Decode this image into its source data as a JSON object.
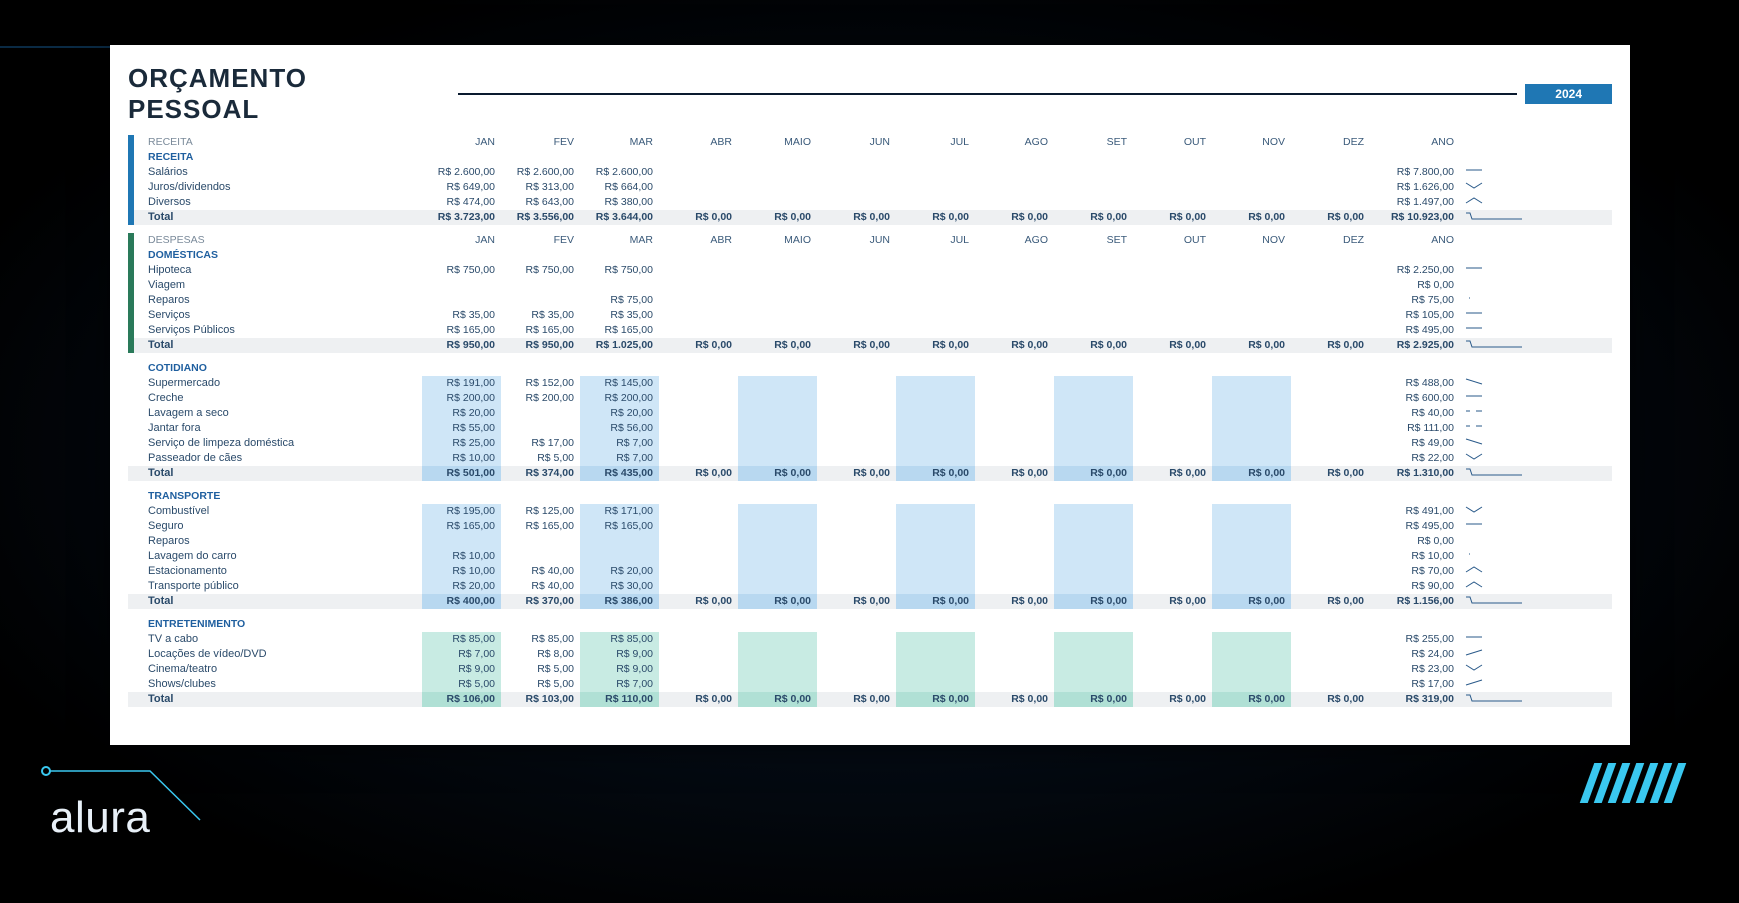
{
  "brand": "alura",
  "title": "ORÇAMENTO PESSOAL",
  "year": "2024",
  "months": [
    "JAN",
    "FEV",
    "MAR",
    "ABR",
    "MAIO",
    "JUN",
    "JUL",
    "AGO",
    "SET",
    "OUT",
    "NOV",
    "DEZ"
  ],
  "yearLabel": "ANO",
  "sections": [
    {
      "id": "receita",
      "bar": "blue",
      "shade": "none",
      "headerLabel": "RECEITA",
      "groupLabel": "RECEITA",
      "rows": [
        {
          "label": "Salários",
          "vals": [
            "R$ 2.600,00",
            "R$ 2.600,00",
            "R$ 2.600,00",
            "",
            "",
            "",
            "",
            "",
            "",
            "",
            "",
            ""
          ],
          "ano": "R$ 7.800,00",
          "spark": "flat"
        },
        {
          "label": "Juros/dividendos",
          "vals": [
            "R$ 649,00",
            "R$ 313,00",
            "R$ 664,00",
            "",
            "",
            "",
            "",
            "",
            "",
            "",
            "",
            ""
          ],
          "ano": "R$ 1.626,00",
          "spark": "v"
        },
        {
          "label": "Diversos",
          "vals": [
            "R$ 474,00",
            "R$ 643,00",
            "R$ 380,00",
            "",
            "",
            "",
            "",
            "",
            "",
            "",
            "",
            ""
          ],
          "ano": "R$ 1.497,00",
          "spark": "nv"
        }
      ],
      "total": {
        "label": "Total",
        "vals": [
          "R$ 3.723,00",
          "R$ 3.556,00",
          "R$ 3.644,00",
          "R$ 0,00",
          "R$ 0,00",
          "R$ 0,00",
          "R$ 0,00",
          "R$ 0,00",
          "R$ 0,00",
          "R$ 0,00",
          "R$ 0,00",
          "R$ 0,00"
        ],
        "ano": "R$ 10.923,00",
        "spark": "drop"
      }
    },
    {
      "id": "despesas",
      "bar": "green",
      "shade": "none",
      "headerLabel": "DESPESAS",
      "groupLabel": "DOMÉSTICAS",
      "rows": [
        {
          "label": "Hipoteca",
          "vals": [
            "R$ 750,00",
            "R$ 750,00",
            "R$ 750,00",
            "",
            "",
            "",
            "",
            "",
            "",
            "",
            "",
            ""
          ],
          "ano": "R$ 2.250,00",
          "spark": "flat"
        },
        {
          "label": "Viagem",
          "vals": [
            "",
            "",
            "",
            "",
            "",
            "",
            "",
            "",
            "",
            "",
            "",
            ""
          ],
          "ano": "R$ 0,00",
          "spark": ""
        },
        {
          "label": "Reparos",
          "vals": [
            "",
            "",
            "R$ 75,00",
            "",
            "",
            "",
            "",
            "",
            "",
            "",
            "",
            ""
          ],
          "ano": "R$ 75,00",
          "spark": "dot"
        },
        {
          "label": "Serviços",
          "vals": [
            "R$ 35,00",
            "R$ 35,00",
            "R$ 35,00",
            "",
            "",
            "",
            "",
            "",
            "",
            "",
            "",
            ""
          ],
          "ano": "R$ 105,00",
          "spark": "flat"
        },
        {
          "label": "Serviços Públicos",
          "vals": [
            "R$ 165,00",
            "R$ 165,00",
            "R$ 165,00",
            "",
            "",
            "",
            "",
            "",
            "",
            "",
            "",
            ""
          ],
          "ano": "R$ 495,00",
          "spark": "flat"
        }
      ],
      "total": {
        "label": "Total",
        "vals": [
          "R$ 950,00",
          "R$ 950,00",
          "R$ 1.025,00",
          "R$ 0,00",
          "R$ 0,00",
          "R$ 0,00",
          "R$ 0,00",
          "R$ 0,00",
          "R$ 0,00",
          "R$ 0,00",
          "R$ 0,00",
          "R$ 0,00"
        ],
        "ano": "R$ 2.925,00",
        "spark": "drop"
      }
    },
    {
      "id": "cotidiano",
      "bar": "",
      "shade": "blue",
      "headerLabel": "",
      "groupLabel": "Cotidiano",
      "rows": [
        {
          "label": "Supermercado",
          "vals": [
            "R$ 191,00",
            "R$ 152,00",
            "R$ 145,00",
            "",
            "",
            "",
            "",
            "",
            "",
            "",
            "",
            ""
          ],
          "ano": "R$ 488,00",
          "spark": "down"
        },
        {
          "label": "Creche",
          "vals": [
            "R$ 200,00",
            "R$ 200,00",
            "R$ 200,00",
            "",
            "",
            "",
            "",
            "",
            "",
            "",
            "",
            ""
          ],
          "ano": "R$ 600,00",
          "spark": "flat"
        },
        {
          "label": "Lavagem a seco",
          "vals": [
            "R$ 20,00",
            "",
            "R$ 20,00",
            "",
            "",
            "",
            "",
            "",
            "",
            "",
            "",
            ""
          ],
          "ano": "R$ 40,00",
          "spark": "gap"
        },
        {
          "label": "Jantar fora",
          "vals": [
            "R$ 55,00",
            "",
            "R$ 56,00",
            "",
            "",
            "",
            "",
            "",
            "",
            "",
            "",
            ""
          ],
          "ano": "R$ 111,00",
          "spark": "gap"
        },
        {
          "label": "Serviço de limpeza doméstica",
          "vals": [
            "R$ 25,00",
            "R$ 17,00",
            "R$ 7,00",
            "",
            "",
            "",
            "",
            "",
            "",
            "",
            "",
            ""
          ],
          "ano": "R$ 49,00",
          "spark": "down"
        },
        {
          "label": "Passeador de cães",
          "vals": [
            "R$ 10,00",
            "R$ 5,00",
            "R$ 7,00",
            "",
            "",
            "",
            "",
            "",
            "",
            "",
            "",
            ""
          ],
          "ano": "R$ 22,00",
          "spark": "v"
        }
      ],
      "total": {
        "label": "Total",
        "vals": [
          "R$ 501,00",
          "R$ 374,00",
          "R$ 435,00",
          "R$ 0,00",
          "R$ 0,00",
          "R$ 0,00",
          "R$ 0,00",
          "R$ 0,00",
          "R$ 0,00",
          "R$ 0,00",
          "R$ 0,00",
          "R$ 0,00"
        ],
        "ano": "R$ 1.310,00",
        "spark": "drop"
      }
    },
    {
      "id": "transporte",
      "bar": "",
      "shade": "blue",
      "headerLabel": "",
      "groupLabel": "TRANSPORTE",
      "rows": [
        {
          "label": "Combustível",
          "vals": [
            "R$ 195,00",
            "R$ 125,00",
            "R$ 171,00",
            "",
            "",
            "",
            "",
            "",
            "",
            "",
            "",
            ""
          ],
          "ano": "R$ 491,00",
          "spark": "v"
        },
        {
          "label": "Seguro",
          "vals": [
            "R$ 165,00",
            "R$ 165,00",
            "R$ 165,00",
            "",
            "",
            "",
            "",
            "",
            "",
            "",
            "",
            ""
          ],
          "ano": "R$ 495,00",
          "spark": "flat"
        },
        {
          "label": "Reparos",
          "vals": [
            "",
            "",
            "",
            "",
            "",
            "",
            "",
            "",
            "",
            "",
            "",
            ""
          ],
          "ano": "R$ 0,00",
          "spark": ""
        },
        {
          "label": "Lavagem do carro",
          "vals": [
            "R$ 10,00",
            "",
            "",
            "",
            "",
            "",
            "",
            "",
            "",
            "",
            "",
            ""
          ],
          "ano": "R$ 10,00",
          "spark": "dot"
        },
        {
          "label": "Estacionamento",
          "vals": [
            "R$ 10,00",
            "R$ 40,00",
            "R$ 20,00",
            "",
            "",
            "",
            "",
            "",
            "",
            "",
            "",
            ""
          ],
          "ano": "R$ 70,00",
          "spark": "nv"
        },
        {
          "label": "Transporte público",
          "vals": [
            "R$ 20,00",
            "R$ 40,00",
            "R$ 30,00",
            "",
            "",
            "",
            "",
            "",
            "",
            "",
            "",
            ""
          ],
          "ano": "R$ 90,00",
          "spark": "nv"
        }
      ],
      "total": {
        "label": "Total",
        "vals": [
          "R$ 400,00",
          "R$ 370,00",
          "R$ 386,00",
          "R$ 0,00",
          "R$ 0,00",
          "R$ 0,00",
          "R$ 0,00",
          "R$ 0,00",
          "R$ 0,00",
          "R$ 0,00",
          "R$ 0,00",
          "R$ 0,00"
        ],
        "ano": "R$ 1.156,00",
        "spark": "drop"
      }
    },
    {
      "id": "entretenimento",
      "bar": "",
      "shade": "teal",
      "headerLabel": "",
      "groupLabel": "ENTRETENIMENTO",
      "rows": [
        {
          "label": "TV a cabo",
          "vals": [
            "R$ 85,00",
            "R$ 85,00",
            "R$ 85,00",
            "",
            "",
            "",
            "",
            "",
            "",
            "",
            "",
            ""
          ],
          "ano": "R$ 255,00",
          "spark": "flat"
        },
        {
          "label": "Locações de vídeo/DVD",
          "vals": [
            "R$ 7,00",
            "R$ 8,00",
            "R$ 9,00",
            "",
            "",
            "",
            "",
            "",
            "",
            "",
            "",
            ""
          ],
          "ano": "R$ 24,00",
          "spark": "up"
        },
        {
          "label": "Cinema/teatro",
          "vals": [
            "R$ 9,00",
            "R$ 5,00",
            "R$ 9,00",
            "",
            "",
            "",
            "",
            "",
            "",
            "",
            "",
            ""
          ],
          "ano": "R$ 23,00",
          "spark": "v"
        },
        {
          "label": "Shows/clubes",
          "vals": [
            "R$ 5,00",
            "R$ 5,00",
            "R$ 7,00",
            "",
            "",
            "",
            "",
            "",
            "",
            "",
            "",
            ""
          ],
          "ano": "R$ 17,00",
          "spark": "up"
        }
      ],
      "total": {
        "label": "Total",
        "vals": [
          "R$ 106,00",
          "R$ 103,00",
          "R$ 110,00",
          "R$ 0,00",
          "R$ 0,00",
          "R$ 0,00",
          "R$ 0,00",
          "R$ 0,00",
          "R$ 0,00",
          "R$ 0,00",
          "R$ 0,00",
          "R$ 0,00"
        ],
        "ano": "R$ 319,00",
        "spark": "drop"
      }
    }
  ]
}
